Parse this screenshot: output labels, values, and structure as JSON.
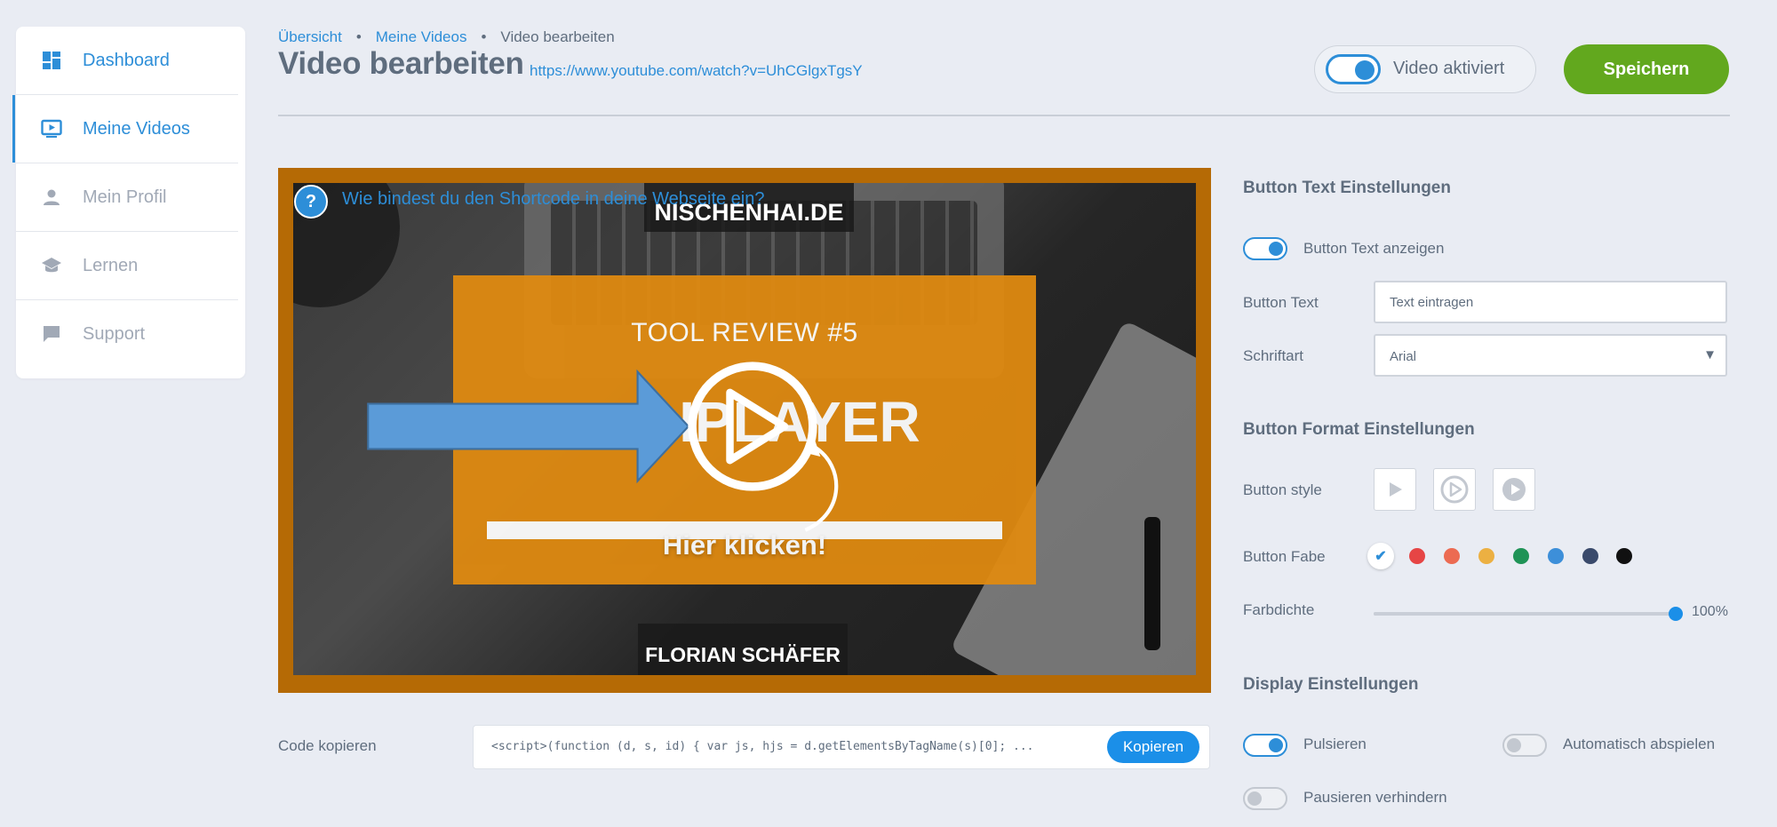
{
  "sidebar": {
    "items": [
      {
        "label": "Dashboard",
        "icon": "dashboard-icon"
      },
      {
        "label": "Meine Videos",
        "icon": "video-icon"
      },
      {
        "label": "Mein Profil",
        "icon": "person-icon"
      },
      {
        "label": "Lernen",
        "icon": "school-icon"
      },
      {
        "label": "Support",
        "icon": "chat-icon"
      }
    ]
  },
  "breadcrumb": [
    "Übersicht",
    "Meine Videos",
    "Video bearbeiten"
  ],
  "header": {
    "title": "Video bearbeiten",
    "url": "https://www.youtube.com/watch?v=UhCGlgxTgsY",
    "toggle_label": "Video aktiviert",
    "toggle_on": true,
    "save_label": "Speichern"
  },
  "video": {
    "help_icon_char": "?",
    "help_text": "Wie bindest du den Shortcode in deine Webseite ein?",
    "brand": "NISCHENHAI.DE",
    "author": "FLORIAN SCHÄFER",
    "card_title": "TOOL REVIEW #5",
    "card_big": "PLAYER",
    "card_big_prefix": "I",
    "card_cta": "Hier klicken!"
  },
  "code": {
    "label": "Code kopieren",
    "snippet": "<script>(function (d, s, id) { var js, hjs = d.getElementsByTagName(s)[0]; ...",
    "copy_label": "Kopieren"
  },
  "panel": {
    "text_section": {
      "title": "Button Text Einstellungen",
      "show_text_label": "Button Text anzeigen",
      "show_text_on": true,
      "button_text_label": "Button Text",
      "button_text_placeholder": "Text eintragen",
      "font_label": "Schriftart",
      "font_value": "Arial"
    },
    "format_section": {
      "title": "Button Format Einstellungen",
      "style_label": "Button style",
      "color_label": "Button Fabe",
      "colors": [
        "#ffffff",
        "#e64545",
        "#ec6b52",
        "#ecb042",
        "#1f9356",
        "#3d8fd9",
        "#3a4a6b",
        "#111111"
      ],
      "selected_color_index": 0,
      "density_label": "Farbdichte",
      "density_value": "100%",
      "density_fraction": 1.0
    },
    "display_section": {
      "title": "Display Einstellungen",
      "pulse_label": "Pulsieren",
      "pulse_on": true,
      "autoplay_label": "Automatisch abspielen",
      "autoplay_on": false,
      "prevent_pause_label": "Pausieren verhindern",
      "prevent_pause_on": false
    }
  },
  "colors": {
    "accent": "#2d8ed8",
    "save": "#62a81e",
    "video_frame": "#b56a05",
    "card": "#e08a10"
  }
}
